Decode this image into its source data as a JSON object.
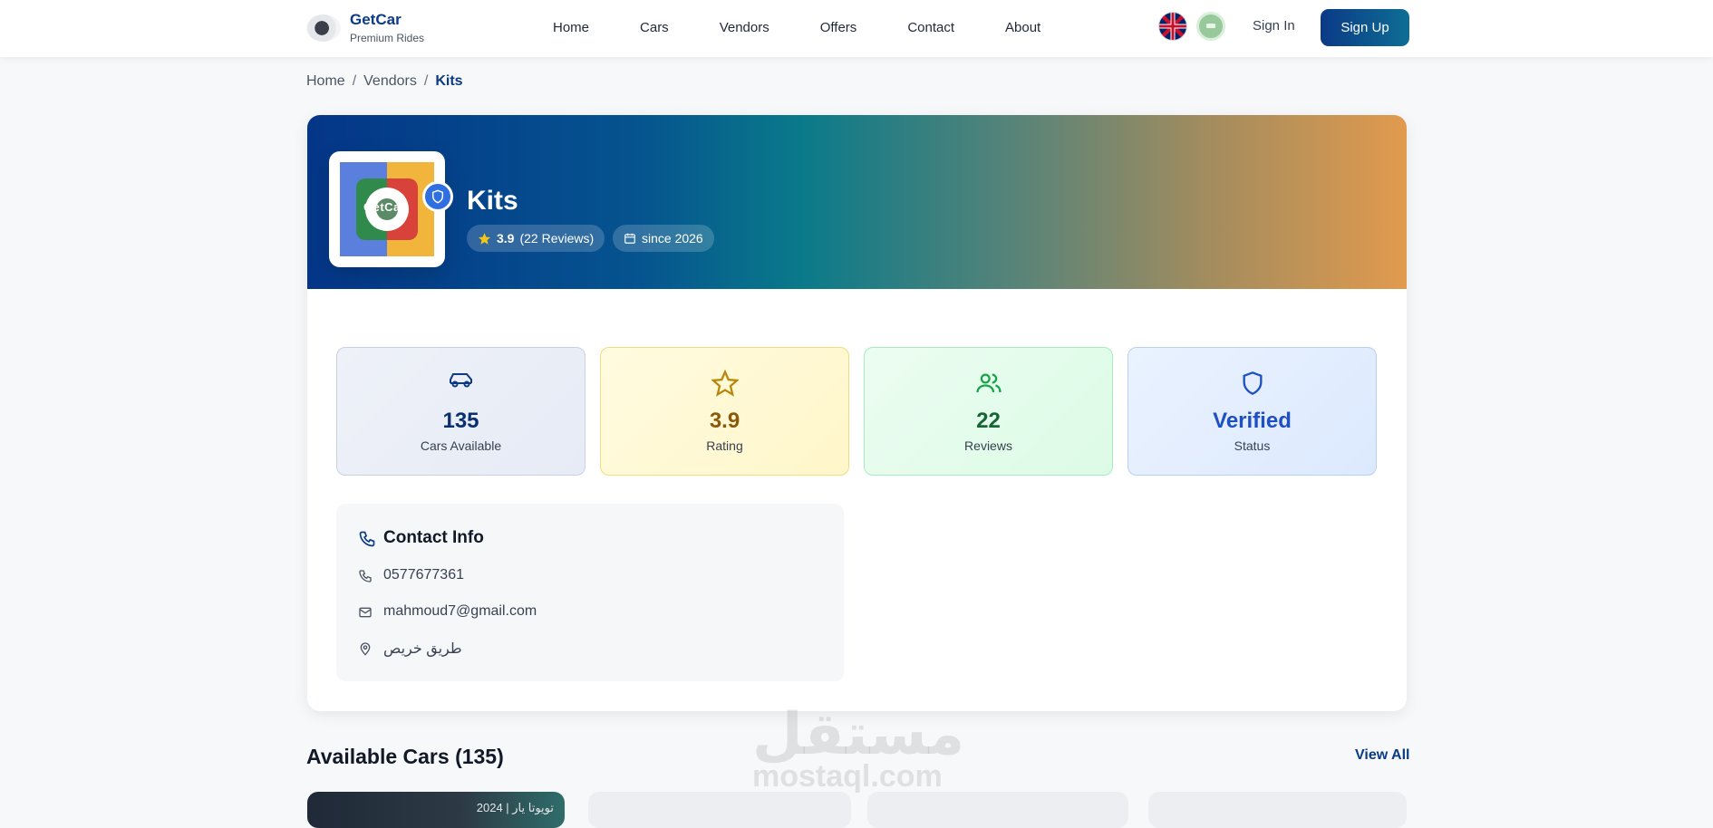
{
  "header": {
    "brand_name": "GetCar",
    "brand_sub": "Premium Rides",
    "nav": [
      "Home",
      "Cars",
      "Vendors",
      "Offers",
      "Contact",
      "About"
    ],
    "sign_in": "Sign In",
    "sign_up": "Sign Up"
  },
  "breadcrumb": {
    "items": [
      "Home",
      "Vendors",
      "Kits"
    ],
    "sep": "/"
  },
  "vendor": {
    "name": "Kits",
    "logo_text": "GetCar",
    "rating": "3.9",
    "reviews_text": "(22 Reviews)",
    "since": "since 2026"
  },
  "stats": [
    {
      "value": "135",
      "label": "Cars Available",
      "icon": "car-icon"
    },
    {
      "value": "3.9",
      "label": "Rating",
      "icon": "star-icon"
    },
    {
      "value": "22",
      "label": "Reviews",
      "icon": "users-icon"
    },
    {
      "value": "Verified",
      "label": "Status",
      "icon": "shield-icon"
    }
  ],
  "contact": {
    "title": "Contact Info",
    "phone": "0577677361",
    "email": "mahmoud7@gmail.com",
    "address": "طريق خريص"
  },
  "cars_section": {
    "title": "Available Cars (135)",
    "view_all": "View All",
    "first_card_text": "2024 | تويوتا يار"
  },
  "watermark": {
    "line1": "مستقل",
    "line2": "mostaql.com"
  },
  "colors": {
    "primary": "#0b3a86",
    "accent": "#2f6fe0",
    "star": "#f5c518"
  }
}
